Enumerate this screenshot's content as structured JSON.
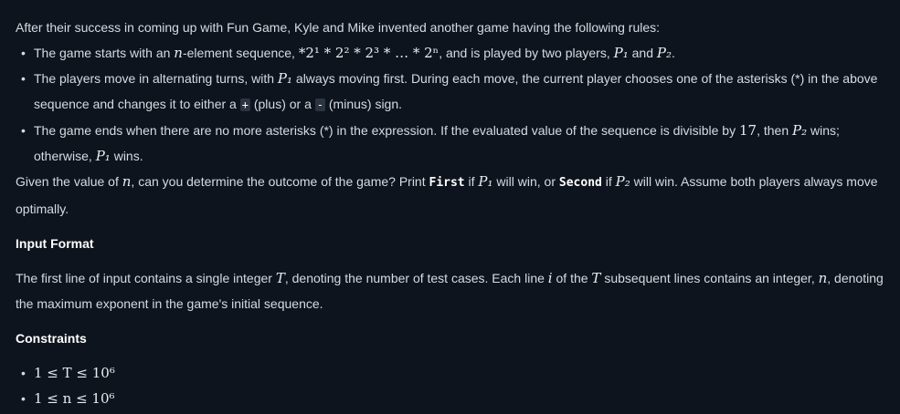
{
  "intro": "After their success in coming up with Fun Game, Kyle and Mike invented another game having the following rules:",
  "rule1": {
    "t1": "The game starts with an ",
    "n": "n",
    "t2": "-element sequence, ",
    "seq": "*2¹ * 2² * 2³ * … * 2ⁿ",
    "t3": ", and is played by two players, ",
    "p1": "P₁",
    "and": " and ",
    "p2": "P₂",
    "end": "."
  },
  "rule2": {
    "t1": "The players move in alternating turns, with ",
    "p1": "P₁",
    "t2": " always moving first. During each move, the current player chooses one of the asterisks (*) in the above sequence and changes it to either a ",
    "plus": "+",
    "t3": " (plus) or a ",
    "minus": "-",
    "t4": " (minus) sign."
  },
  "rule3": {
    "t1": "The game ends when there are no more asterisks (*) in the expression. If the evaluated value of the sequence is divisible by ",
    "num": "17",
    "t2": ", then ",
    "p2": "P₂",
    "t3": " wins; otherwise, ",
    "p1": "P₁",
    "t4": " wins."
  },
  "question": {
    "t1": "Given the value of ",
    "n": "n",
    "t2": ", can you determine the outcome of the game? Print ",
    "first": "First",
    "t3": " if ",
    "p1": "P₁",
    "t4": " will win, or ",
    "second": "Second",
    "t5": " if ",
    "p2": "P₂",
    "t6": " will win. Assume both players always move optimally."
  },
  "input_heading": "Input Format",
  "input": {
    "t1": "The first line of input contains a single integer ",
    "T": "T",
    "t2": ", denoting the number of test cases. Each line ",
    "i": "i",
    "t3": " of the ",
    "T2": "T",
    "t4": " subsequent lines contains an integer, ",
    "n": "n",
    "t5": ", denoting the maximum exponent in the game's initial sequence."
  },
  "constraints_heading": "Constraints",
  "constraints": [
    "1 ≤ T ≤ 10⁶",
    "1 ≤ n ≤ 10⁶"
  ]
}
